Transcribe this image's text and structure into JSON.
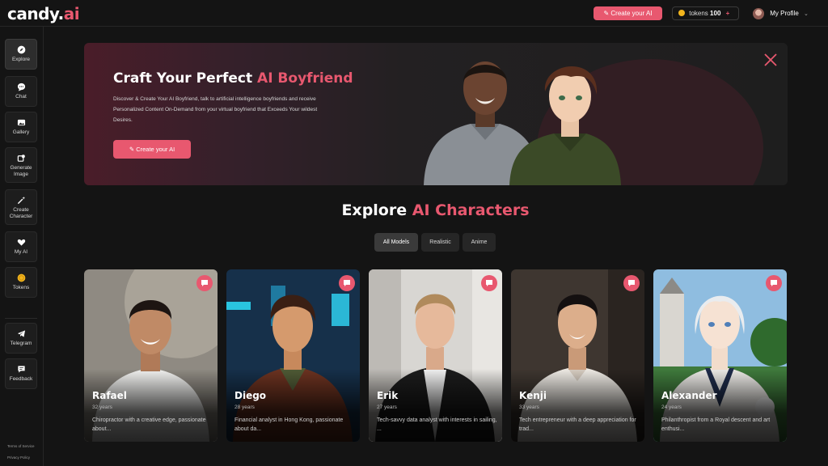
{
  "brand": {
    "logo_main": "candy.",
    "logo_accent": "ai"
  },
  "topbar": {
    "create_label": "Create your AI",
    "tokens_label": "tokens",
    "tokens_value": "100",
    "tokens_plus": "+",
    "profile_label": "My Profile"
  },
  "sidebar": {
    "items": [
      {
        "label": "Explore",
        "icon": "compass-icon"
      },
      {
        "label": "Chat",
        "icon": "chat-bubble-icon"
      },
      {
        "label": "Gallery",
        "icon": "gallery-icon"
      },
      {
        "label": "Generate Image",
        "icon": "image-generate-icon"
      },
      {
        "label": "Create Character",
        "icon": "magic-wand-icon"
      },
      {
        "label": "My AI",
        "icon": "heart-icon"
      },
      {
        "label": "Tokens",
        "icon": "coin-icon"
      },
      {
        "label": "Telegram",
        "icon": "telegram-icon"
      },
      {
        "label": "Feedback",
        "icon": "feedback-icon"
      }
    ],
    "terms": "Terms of Service",
    "privacy": "Privacy Policy"
  },
  "hero": {
    "title_main": "Craft Your Perfect ",
    "title_accent": "AI Boyfriend",
    "description": "Discover & Create Your AI Boyfriend, talk to artificial intelligence boyfriends and receive Personalized Content On-Demand from your virtual boyfriend that Exceeds Your wildest Desires.",
    "button_label": "Create your AI"
  },
  "section": {
    "title_main": "Explore ",
    "title_accent": "AI Characters"
  },
  "filters": [
    {
      "label": "All Models",
      "active": true
    },
    {
      "label": "Realistic",
      "active": false
    },
    {
      "label": "Anime",
      "active": false
    }
  ],
  "characters": [
    {
      "name": "Rafael",
      "age": "32 years",
      "bio": "Chiropractor with a creative edge, passionate about..."
    },
    {
      "name": "Diego",
      "age": "28 years",
      "bio": "Financial analyst in Hong Kong, passionate about da..."
    },
    {
      "name": "Erik",
      "age": "27 years",
      "bio": "Tech-savvy data analyst with interests in sailing, ..."
    },
    {
      "name": "Kenji",
      "age": "33 years",
      "bio": "Tech entrepreneur with a deep appreciation for trad..."
    },
    {
      "name": "Alexander",
      "age": "24 years",
      "bio": "Philanthropist from a Royal descent and art enthusi..."
    }
  ],
  "colors": {
    "accent": "#e8586f",
    "background": "#141414",
    "panel": "#1d1d1d"
  }
}
